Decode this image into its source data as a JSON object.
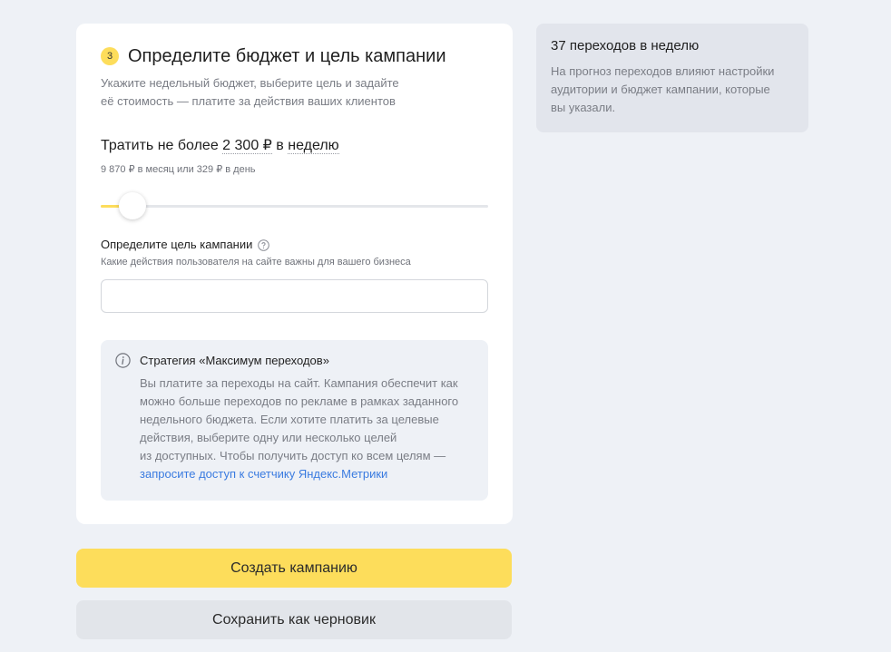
{
  "step": {
    "number": "3",
    "title": "Определите бюджет и цель кампании",
    "desc_lines": [
      "Укажите недельный бюджет, выберите цель и задайте",
      "её стоимость — платите за действия ваших клиентов"
    ]
  },
  "budget": {
    "prefix": "Тратить не более",
    "amount": "2 300 ₽",
    "in_word": "в",
    "period": "неделю",
    "sub": "9 870 ₽ в месяц или 329 ₽ в день",
    "slider_fraction": 0.083
  },
  "goal": {
    "label": "Определите цель кампании",
    "sub": "Какие действия пользователя на сайте важны для вашего бизнеса",
    "input_value": "",
    "input_placeholder": ""
  },
  "strategy": {
    "title": "Стратегия «Максимум переходов»",
    "lines": [
      "Вы платите за переходы на сайт. Кампания обеспечит как",
      "можно больше переходов по рекламе в рамках заданного",
      "недельного бюджета. Если хотите платить за целевые",
      "действия, выберите одну или несколько целей",
      "из доступных. Чтобы получить доступ ко всем целям —"
    ],
    "link": "запросите доступ к счетчику Яндекс.Метрики"
  },
  "actions": {
    "create": "Создать кампанию",
    "save_draft": "Сохранить как черновик"
  },
  "forecast": {
    "title": "37 переходов в неделю",
    "lines": [
      "На прогноз переходов влияют настройки",
      "аудитории и бюджет кампании, которые",
      "вы указали."
    ]
  },
  "colors": {
    "accent_yellow": "#fddd5b",
    "link_blue": "#3a7be0",
    "page_bg": "#eef1f6"
  },
  "icons": [
    "help-icon",
    "info-icon"
  ]
}
